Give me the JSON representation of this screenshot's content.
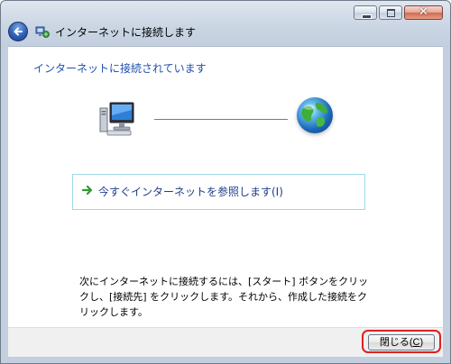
{
  "window": {
    "title": "インターネットに接続します",
    "controls": {
      "minimize": "minimize",
      "maximize": "maximize",
      "close": "✕"
    }
  },
  "content": {
    "heading": "インターネットに接続されています",
    "link_text": "今すぐインターネットを参照します(I)",
    "instructions": [
      "次にインターネットに接続するには、[スタート] ボタンをクリッ",
      "クし、[接続先] をクリックします。それから、作成した接続をク",
      "リックします。"
    ]
  },
  "footer": {
    "close_button_label": "閉じる(",
    "close_button_key": "C",
    "close_button_suffix": ")"
  },
  "colors": {
    "heading": "#1e4fb0",
    "link_border": "#9fd8e8",
    "highlight": "#e02020",
    "arrow": "#2e9b2e"
  },
  "icons": {
    "back": "back-arrow-icon",
    "wizard": "network-wizard-icon",
    "computer": "computer-icon",
    "globe": "globe-icon",
    "link_arrow": "green-arrow-icon"
  }
}
